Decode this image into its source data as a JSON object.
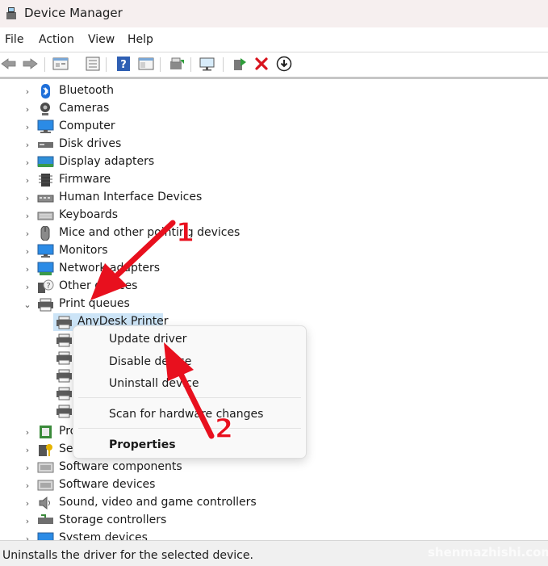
{
  "window": {
    "title": "Device Manager"
  },
  "menu": [
    "File",
    "Action",
    "View",
    "Help"
  ],
  "toolbar": {
    "buttons": [
      "back-arrow-icon",
      "forward-arrow-icon",
      "properties-icon",
      "show-hidden-icon",
      "help-icon",
      "action-view-icon",
      "update-driver-icon",
      "scan-hardware-icon",
      "enable-device-icon",
      "uninstall-x-icon",
      "download-circle-icon"
    ]
  },
  "tree": {
    "categories_top": [
      {
        "label": "Bluetooth",
        "icon": "bluetooth-icon"
      },
      {
        "label": "Cameras",
        "icon": "camera-icon"
      },
      {
        "label": "Computer",
        "icon": "computer-icon"
      },
      {
        "label": "Disk drives",
        "icon": "disk-drive-icon"
      },
      {
        "label": "Display adapters",
        "icon": "display-adapter-icon"
      },
      {
        "label": "Firmware",
        "icon": "firmware-icon"
      },
      {
        "label": "Human Interface Devices",
        "icon": "hid-icon"
      },
      {
        "label": "Keyboards",
        "icon": "keyboard-icon"
      },
      {
        "label": "Mice and other pointing devices",
        "icon": "mouse-icon"
      },
      {
        "label": "Monitors",
        "icon": "monitor-icon"
      },
      {
        "label": "Network adapters",
        "icon": "network-adapter-icon"
      },
      {
        "label": "Other devices",
        "icon": "unknown-device-icon"
      },
      {
        "label": "Print queues",
        "icon": "printer-icon",
        "expanded": true
      }
    ],
    "print_queue_children": [
      {
        "label": "AnyDesk Printer",
        "selected": true
      },
      {
        "label": ""
      },
      {
        "label": ""
      },
      {
        "label": ""
      },
      {
        "label": ""
      },
      {
        "label": ""
      }
    ],
    "categories_bottom": [
      {
        "label": "Pro",
        "icon": "processor-icon"
      },
      {
        "label": "Se",
        "icon": "security-device-icon"
      },
      {
        "label": "Software components",
        "icon": "software-component-icon"
      },
      {
        "label": "Software devices",
        "icon": "software-device-icon"
      },
      {
        "label": "Sound, video and game controllers",
        "icon": "sound-icon"
      },
      {
        "label": "Storage controllers",
        "icon": "storage-controller-icon"
      },
      {
        "label": "System devices",
        "icon": "system-device-icon"
      }
    ]
  },
  "context_menu": {
    "items": [
      {
        "label": "Update driver"
      },
      {
        "label": "Disable device"
      },
      {
        "label": "Uninstall device"
      },
      {
        "label": "Scan for hardware changes"
      },
      {
        "label": "Properties",
        "bold": true
      }
    ]
  },
  "annotations": {
    "arrow1_label": "1",
    "arrow2_label": "2",
    "color": "#e8101e"
  },
  "status": {
    "text": "Uninstalls the driver for the selected device."
  },
  "watermark": "shenmazhishi.com"
}
